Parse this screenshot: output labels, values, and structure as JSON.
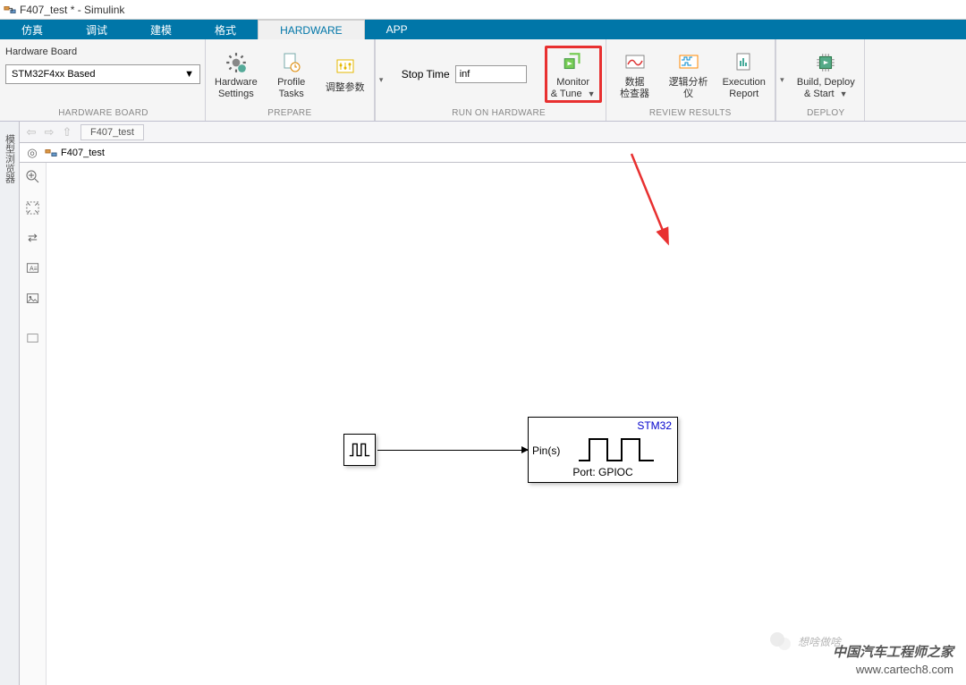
{
  "window": {
    "title": "F407_test * - Simulink"
  },
  "tabs": {
    "sim": "仿真",
    "debug": "调试",
    "model": "建模",
    "format": "格式",
    "hardware": "HARDWARE",
    "app": "APP"
  },
  "ribbon": {
    "hwboard_group": "HARDWARE BOARD",
    "hwboard_label": "Hardware Board",
    "hwboard_value": "STM32F4xx Based",
    "prepare_group": "PREPARE",
    "hw_settings": "Hardware\nSettings",
    "profile_tasks": "Profile\nTasks",
    "tune_params": "调整参数",
    "run_group": "RUN ON HARDWARE",
    "stop_time_label": "Stop Time",
    "stop_time_value": "inf",
    "monitor_tune": "Monitor\n& Tune",
    "review_group": "REVIEW RESULTS",
    "data_inspector": "数据\n检查器",
    "logic_analyzer": "逻辑分析\n仪",
    "exec_report": "Execution\nReport",
    "deploy_group": "DEPLOY",
    "build_deploy": "Build, Deploy\n& Start"
  },
  "side_tab": "模型浏览器",
  "breadcrumb": {
    "model_name": "F407_test"
  },
  "model_tree": {
    "root": "F407_test"
  },
  "canvas": {
    "sink_title": "STM32",
    "sink_pins": "Pin(s)",
    "sink_port": "Port: GPIOC"
  },
  "watermark": {
    "zh_brand": "想啥做啥",
    "zh": "中国汽车工程师之家",
    "url": "www.cartech8.com"
  }
}
